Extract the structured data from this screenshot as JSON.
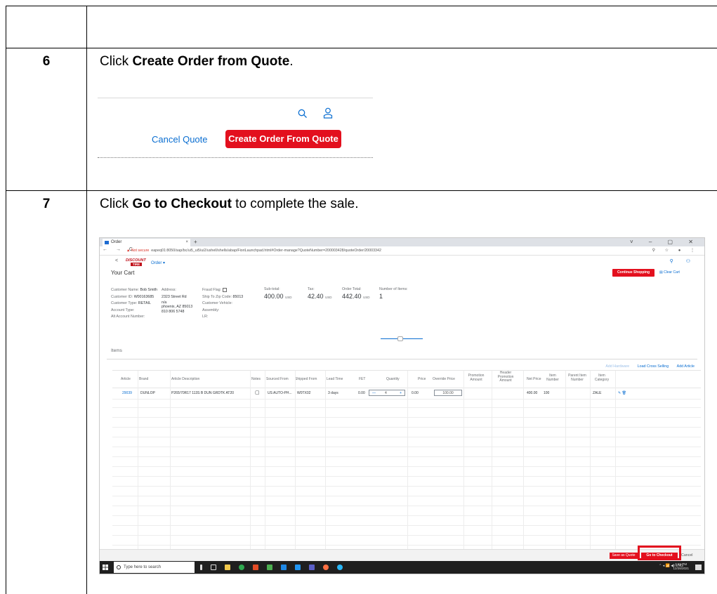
{
  "steps": [
    {
      "num": "6",
      "text_before": "Click ",
      "bold": "Create Order from Quote",
      "text_after": "."
    },
    {
      "num": "7",
      "text_before": "Click ",
      "bold": "Go to Checkout",
      "text_after": " to complete the sale."
    }
  ],
  "snippet6": {
    "cancel_label": "Cancel Quote",
    "create_label": "Create Order From Quote"
  },
  "browser": {
    "tab_title": "Order",
    "new_tab": "+",
    "window_buttons": "˅ – ▢ ✕",
    "nav_buttons": "← → C",
    "warning": "▲ Not secure",
    "url": "eapeq01:8050/sap/bc/ui5_ui5/ui2/ushell/shells/abap/FioriLaunchpad.html#Order-manage?QuoteNumber=200003428/quoteOrder/20003342",
    "addr_icons": "⚲ ☆ ● ⋮"
  },
  "app": {
    "back": "<",
    "logo_line1": "DISCOUNT",
    "logo_line2": "TIRE",
    "menu": "Order ▾",
    "title": "Your Cart",
    "continue_shopping": "Continue Shopping",
    "clear_cart": "Clear Cart",
    "customer": {
      "name_label": "Customer Name:",
      "name": "Bob Smith",
      "id_label": "Customer ID:",
      "id": "W00163685",
      "type_label": "Customer Type:",
      "type": "RETAIL",
      "account_type_label": "Account Type:",
      "alt_account_label": "Alt Account Number:"
    },
    "address": {
      "label": "Address:",
      "line1": "2323 Street Rd",
      "line2": "n/a",
      "line3": "phoenix, AZ 85013",
      "phone": "810 806 5748"
    },
    "fraud": {
      "flag_label": "Fraud Flag:",
      "zip_label": "Ship To Zip Code:",
      "zip": "85013",
      "vehicle_label": "Customer Vehicle:",
      "assembly_label": "Assembly:",
      "lr_label": "LR:"
    },
    "totals": [
      {
        "label": "Sub-total:",
        "amount": "400.00",
        "unit": "USD"
      },
      {
        "label": "Tax:",
        "amount": "42.40",
        "unit": "USD"
      },
      {
        "label": "Order Total:",
        "amount": "442.40",
        "unit": "USD"
      },
      {
        "label": "Number of Items:",
        "amount": "1",
        "unit": ""
      }
    ],
    "items_label": "Items",
    "table_actions": {
      "add_hardware": "Add Hardware",
      "load_cross": "Load Cross Selling",
      "add_article": "Add Article"
    },
    "columns": [
      "Article",
      "Brand",
      "Article Description",
      "Notes",
      "Sourced From",
      "Shipped From",
      "Lead Time",
      "FET",
      "Quantity",
      "Price",
      "Override Price",
      "Promotion Amount",
      "Header Promotion Amount",
      "Net Price",
      "Item Number",
      "Parent Item Number",
      "Item Category"
    ],
    "row": {
      "article": "29039",
      "brand": "DUNLOP",
      "description": "P265/70R17 113S B DUN GRDTK AT20",
      "sourced": "US AUTO-PH...",
      "shipped": "W0TX02",
      "lead": "3 days",
      "fet": "0.00",
      "qty_minus": "—",
      "qty": "4",
      "qty_plus": "+",
      "price": "0.00",
      "override": "100.00",
      "net": "400.00",
      "item_no": "100",
      "category": "ZALE",
      "actions": "✎ 🗑"
    },
    "footer": {
      "save_quote": "Save as Quote",
      "checkout": "Go to Checkout",
      "cancel": "Cancel"
    }
  },
  "taskbar": {
    "search_placeholder": "Type here to search",
    "tray": "⌃ ◂ 📶 ◀) ENG",
    "time": "1:41 PM",
    "date": "12/28/2021"
  }
}
